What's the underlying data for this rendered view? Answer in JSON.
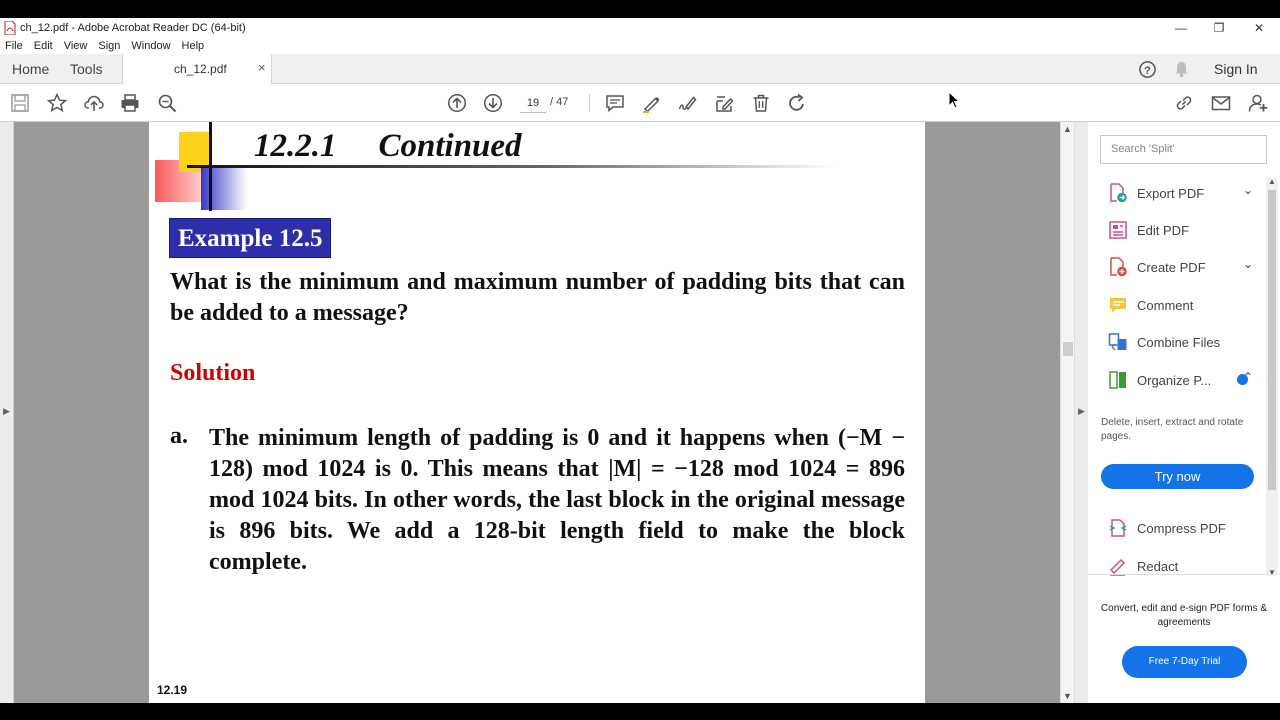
{
  "window": {
    "title": "ch_12.pdf - Adobe Acrobat Reader DC (64-bit)",
    "controls": {
      "minimize": "—",
      "restore": "❐",
      "close": "✕"
    }
  },
  "menu": [
    "File",
    "Edit",
    "View",
    "Sign",
    "Window",
    "Help"
  ],
  "tabs": {
    "home": "Home",
    "tools": "Tools",
    "document": "ch_12.pdf",
    "close": "×",
    "sign_in": "Sign In"
  },
  "toolbar": {
    "page_current": "19",
    "page_total": "/ 47",
    "icons": [
      "save-icon",
      "bookmark-star-icon",
      "upload-icon",
      "print-icon",
      "zoom-search-icon",
      "page-up-icon",
      "page-down-icon",
      "comment-icon",
      "highlight-pen-icon",
      "sign-icon",
      "fill-sign-icon",
      "delete-icon",
      "rotate-icon",
      "share-link-icon",
      "email-icon",
      "add-user-icon"
    ]
  },
  "document": {
    "section_number": "12.2.1",
    "section_title": "Continued",
    "example_label": "Example 12.5",
    "question": "What is the minimum and maximum number of padding bits that can be added to a message?",
    "solution_label": "Solution",
    "answer_letter": "a.",
    "answer_text": "The minimum length of padding is 0 and it happens when (−M − 128) mod 1024 is 0. This means that |M| = −128 mod 1024 = 896 mod 1024 bits. In other words, the last block in the original message is 896 bits. We add a 128-bit length field to make the block complete.",
    "page_number": "12.19"
  },
  "right_pane": {
    "search_placeholder": "Search 'Split'",
    "tools": [
      {
        "label": "Export PDF",
        "icon": "export-pdf-icon",
        "chevron": "⌄"
      },
      {
        "label": "Edit PDF",
        "icon": "edit-pdf-icon"
      },
      {
        "label": "Create PDF",
        "icon": "create-pdf-icon",
        "chevron": "⌄"
      },
      {
        "label": "Comment",
        "icon": "comment-tool-icon"
      },
      {
        "label": "Combine Files",
        "icon": "combine-files-icon"
      },
      {
        "label": "Organize P...",
        "icon": "organize-pages-icon",
        "chevron": "⌃"
      },
      {
        "label": "Compress PDF",
        "icon": "compress-pdf-icon"
      },
      {
        "label": "Redact",
        "icon": "redact-icon"
      }
    ],
    "organize_description": "Delete, insert, extract and rotate pages.",
    "try_now": "Try now",
    "promo_text": "Convert, edit and e-sign PDF forms & agreements",
    "trial_button": "Free 7-Day Trial"
  },
  "colors": {
    "accent_blue": "#1473e6",
    "example_badge": "#2e2eaa",
    "solution_red": "#d00000",
    "doc_background": "#9a9a9a"
  }
}
